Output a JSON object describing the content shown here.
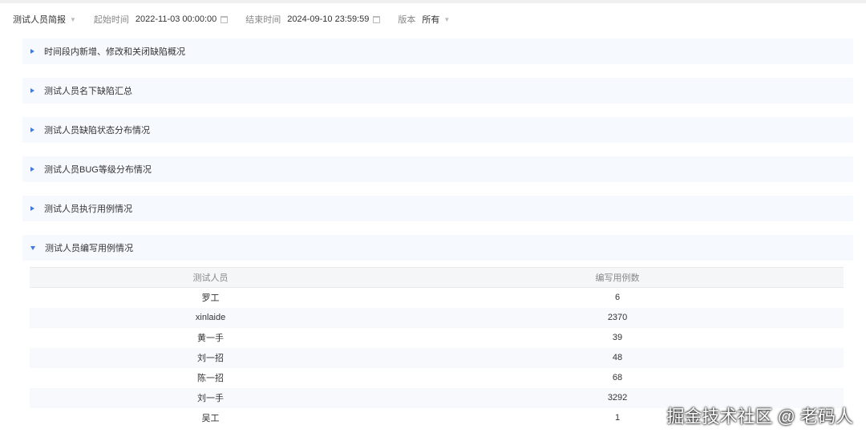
{
  "filters": {
    "report": "测试人员简报",
    "start_label": "起始时间",
    "start_value": "2022-11-03 00:00:00",
    "end_label": "结束时间",
    "end_value": "2024-09-10 23:59:59",
    "version_label": "版本",
    "version_value": "所有"
  },
  "panels": [
    "时间段内新增、修改和关闭缺陷概况",
    "测试人员名下缺陷汇总",
    "测试人员缺陷状态分布情况",
    "测试人员BUG等级分布情况",
    "测试人员执行用例情况",
    "测试人员编写用例情况"
  ],
  "table": {
    "headers": [
      "测试人员",
      "编写用例数"
    ],
    "rows": [
      [
        "罗工",
        "6"
      ],
      [
        "xinlaide",
        "2370"
      ],
      [
        "黄一手",
        "39"
      ],
      [
        "刘一招",
        "48"
      ],
      [
        "陈一招",
        "68"
      ],
      [
        "刘一手",
        "3292"
      ],
      [
        "吴工",
        "1"
      ]
    ]
  },
  "watermark": "掘金技术社区 @ 老码人"
}
